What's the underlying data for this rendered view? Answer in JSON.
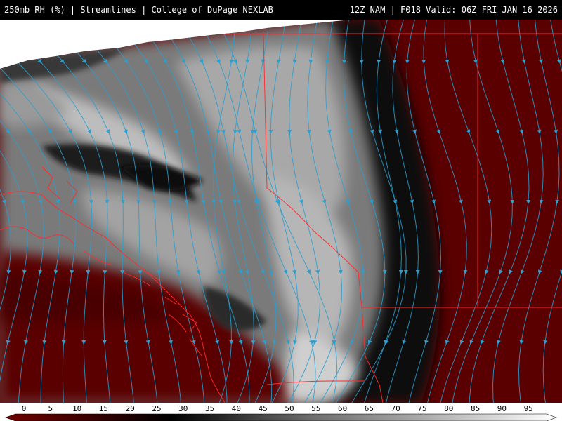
{
  "header": {
    "left_title": "250mb RH (%) | Streamlines | College of DuPage NEXLAB",
    "right_title": "12Z NAM | F018 Valid: 06Z FRI JAN 16 2026"
  },
  "map": {
    "variable": "Relative humidity",
    "level": "250mb",
    "overlay": "Streamlines",
    "colors": {
      "dry": "#5a0000",
      "mid": "#7d7d7d",
      "moist": "#dcdcdc",
      "streamline": "#2a9fd0",
      "borders": "#ff2a2a"
    }
  },
  "legend": {
    "ticks": [
      "0",
      "5",
      "10",
      "15",
      "20",
      "25",
      "30",
      "35",
      "40",
      "45",
      "50",
      "55",
      "60",
      "65",
      "70",
      "75",
      "80",
      "85",
      "90",
      "95"
    ],
    "stops": [
      {
        "value": 0,
        "color": "#6e0000"
      },
      {
        "value": 15,
        "color": "#3a0000"
      },
      {
        "value": 30,
        "color": "#000000"
      },
      {
        "value": 55,
        "color": "#6a6a6a"
      },
      {
        "value": 75,
        "color": "#a8a8a8"
      },
      {
        "value": 100,
        "color": "#ffffff"
      }
    ]
  }
}
